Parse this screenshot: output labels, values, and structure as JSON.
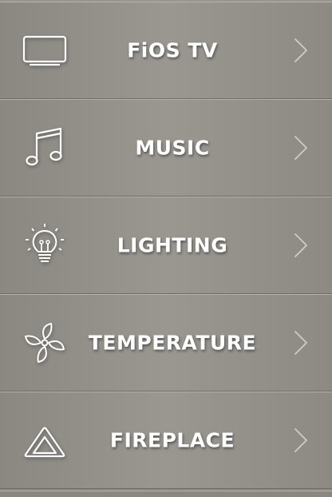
{
  "menu": {
    "items": [
      {
        "id": "fios-tv",
        "label": "FiOS TV",
        "icon": "tv-icon"
      },
      {
        "id": "music",
        "label": "MUSIC",
        "icon": "music-note-icon"
      },
      {
        "id": "lighting",
        "label": "LIGHTING",
        "icon": "lightbulb-icon"
      },
      {
        "id": "temperature",
        "label": "TEMPERATURE",
        "icon": "fan-icon"
      },
      {
        "id": "fireplace",
        "label": "FIREPLACE",
        "icon": "fireplace-icon"
      }
    ],
    "chevron_icon": "chevron-right-icon"
  },
  "colors": {
    "text": "#ffffff",
    "background": "#95928c",
    "divider_light": "#b6b3ad",
    "divider_dark": "#6f6c67",
    "chevron": "#cfccc6"
  }
}
